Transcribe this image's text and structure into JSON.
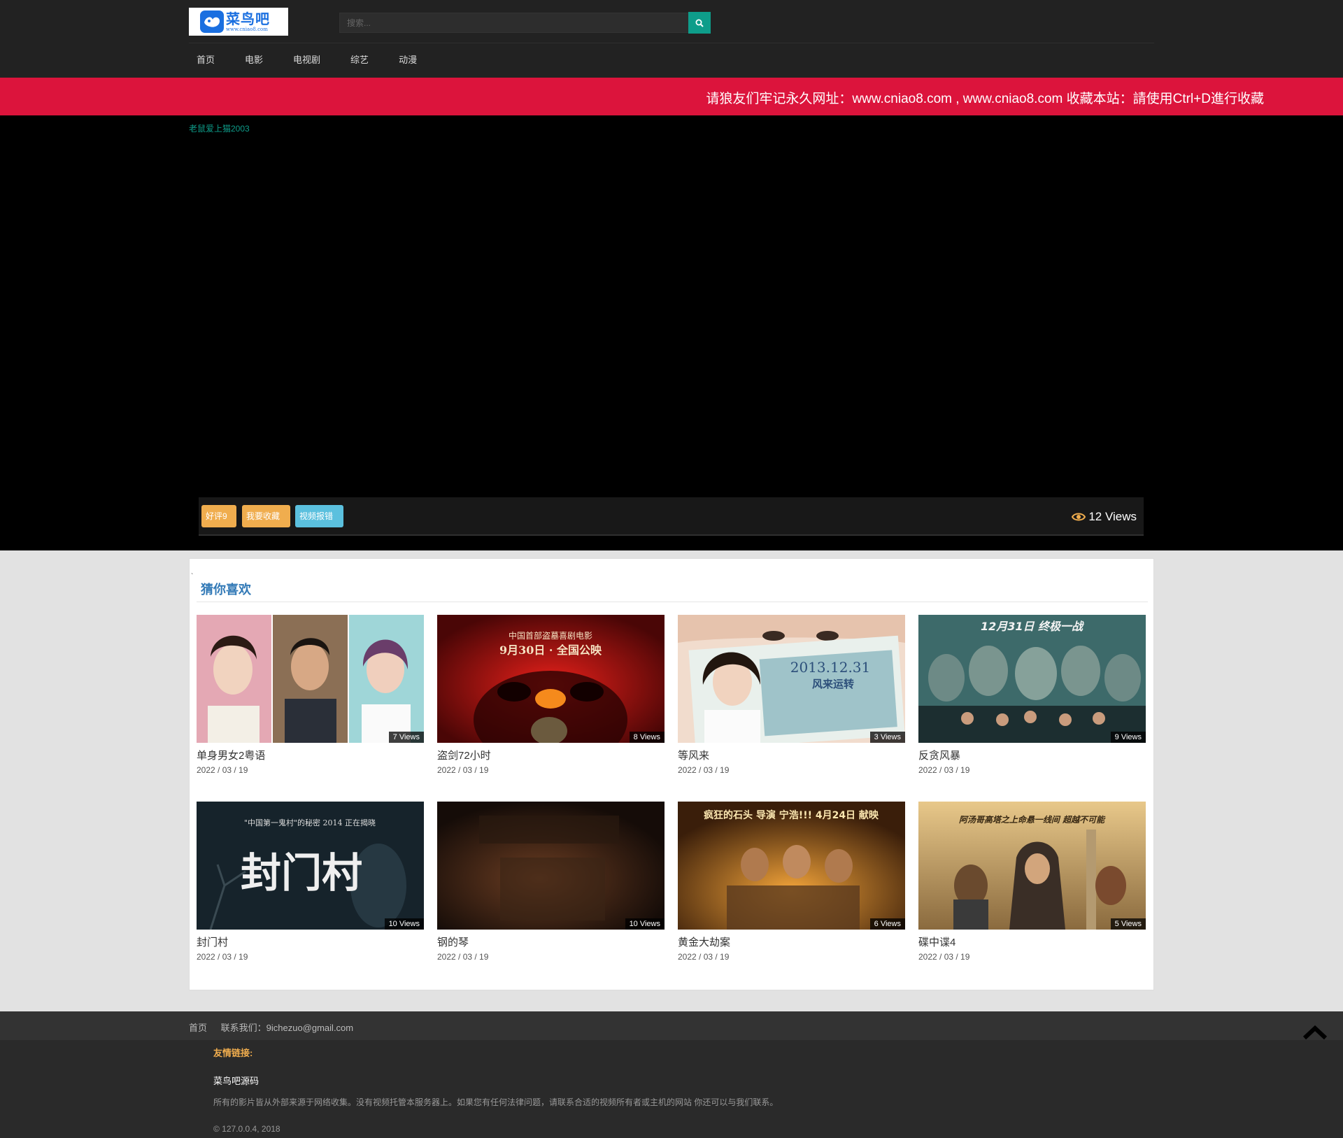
{
  "header": {
    "logo_text": "菜鸟吧",
    "logo_url_text": "www.cniao8.com",
    "search_placeholder": "搜索...",
    "nav": [
      "首页",
      "电影",
      "电视剧",
      "综艺",
      "动漫"
    ]
  },
  "notice": {
    "text": "请狼友们牢记永久网址：www.cniao8.com , www.cniao8.com 收藏本站：請使用Ctrl+D進行收藏"
  },
  "player": {
    "breadcrumb": "老鼠爱上猫2003",
    "like_button": "好评9",
    "favorite_button": "我要收藏",
    "report_button": "视频报错",
    "views": "12 Views"
  },
  "recommend": {
    "tick": "`",
    "title": "猜你喜欢",
    "items": [
      {
        "title": "单身男女2粤语",
        "date": "2022 / 03 / 19",
        "views": "7 Views"
      },
      {
        "title": "盗剑72小时",
        "date": "2022 / 03 / 19",
        "views": "8 Views"
      },
      {
        "title": "等风来",
        "date": "2022 / 03 / 19",
        "views": "3 Views"
      },
      {
        "title": "反贪风暴",
        "date": "2022 / 03 / 19",
        "views": "9 Views"
      },
      {
        "title": "封门村",
        "date": "2022 / 03 / 19",
        "views": "10 Views"
      },
      {
        "title": "钢的琴",
        "date": "2022 / 03 / 19",
        "views": "10 Views"
      },
      {
        "title": "黄金大劫案",
        "date": "2022 / 03 / 19",
        "views": "6 Views"
      },
      {
        "title": "碟中谍4",
        "date": "2022 / 03 / 19",
        "views": "5 Views"
      }
    ],
    "poster_texts": {
      "p2_line1": "中国首部盗墓喜剧电影",
      "p2_line2": "9月30日 · 全国公映",
      "p3_line1": "2013.12.31",
      "p3_line2": "风来运转",
      "p4_line1": "12月31日 终极一战",
      "p5_line1": "\"中国第一鬼村\"的秘密 2014 正在揭晓",
      "p5_line2": "封门村",
      "p7_line1": "疯狂的石头 导演 宁浩!!! 4月24日 献映",
      "p8_line1": "阿汤哥高塔之上命悬一线间 超越不可能"
    }
  },
  "footer": {
    "home_link": "首页",
    "contact": "联系我们：9ichezuo@gmail.com",
    "friend_links_label": "友情链接:",
    "site_name": "菜鸟吧源码",
    "disclaimer": "所有的影片皆从外部来源于网络收集。没有视频托管本服务器上。如果您有任何法律问题，请联系合适的视频所有者或主机的网站 你还可以与我们联系。",
    "copyright": "© 127.0.0.4, 2018"
  },
  "colors": {
    "accent": "#0e9d8a",
    "notice_bg": "#dc143c",
    "title_blue": "#337ab7",
    "btn_orange": "#f0ad4e",
    "btn_cyan": "#5bc0de"
  }
}
